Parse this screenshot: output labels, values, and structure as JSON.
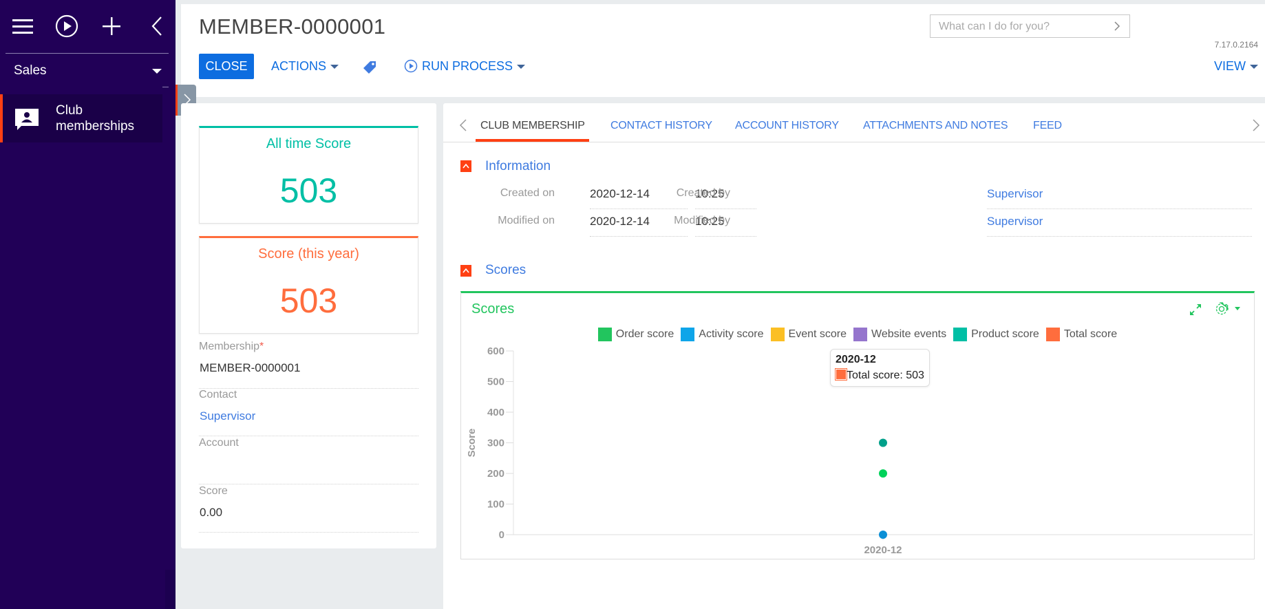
{
  "sidebar": {
    "icons": [
      "menu-icon",
      "run-process-icon",
      "add-icon",
      "collapse-left-icon"
    ],
    "section": "Sales",
    "items": [
      {
        "label_line1": "Club",
        "label_line2": "memberships",
        "icon": "membership-card-icon",
        "active": true
      }
    ],
    "accent_color": "#ff4013",
    "background_color": "#210057"
  },
  "header": {
    "title": "MEMBER-0000001",
    "close_label": "CLOSE",
    "actions_label": "ACTIONS",
    "tag_icon": "tag-icon",
    "run_process_label": "RUN PROCESS",
    "search_placeholder": "What can I do for you?",
    "search_value": "",
    "version": "7.17.0.2164",
    "view_label": "VIEW"
  },
  "left_panel": {
    "tiles": [
      {
        "label": "All time Score",
        "value": "503",
        "color": "#00bfa5"
      },
      {
        "label": "Score (this year)",
        "value": "503",
        "color": "#ff6d3d"
      }
    ],
    "fields": [
      {
        "label": "Membership",
        "required": "*",
        "value": "MEMBER-0000001",
        "is_link": false
      },
      {
        "label": "Contact",
        "value": "Supervisor",
        "is_link": true
      },
      {
        "label": "Account",
        "value": "",
        "is_link": true
      },
      {
        "label": "Score",
        "value": "0.00",
        "is_link": false
      }
    ]
  },
  "tabs": {
    "items": [
      {
        "label": "CLUB MEMBERSHIP",
        "active": true
      },
      {
        "label": "CONTACT HISTORY",
        "active": false
      },
      {
        "label": "ACCOUNT HISTORY",
        "active": false
      },
      {
        "label": "ATTACHMENTS AND NOTES",
        "active": false
      },
      {
        "label": "FEED",
        "active": false
      }
    ]
  },
  "information": {
    "title": "Information",
    "created_on_label": "Created on",
    "created_on_date": "2020-12-14",
    "created_on_time": "10:25",
    "modified_on_label": "Modified on",
    "modified_on_date": "2020-12-14",
    "modified_on_time": "10:25",
    "created_by_label": "Created by",
    "created_by": "Supervisor",
    "modified_by_label": "Modified by",
    "modified_by": "Supervisor"
  },
  "scores_group": {
    "title": "Scores"
  },
  "chart_data": {
    "type": "scatter",
    "title": "Scores",
    "xlabel": "",
    "ylabel": "Score",
    "categories": [
      "2020-12"
    ],
    "ylim": [
      0,
      600
    ],
    "yticks": [
      0,
      100,
      200,
      300,
      400,
      500,
      600
    ],
    "grid": false,
    "legend_position": "top-center",
    "series": [
      {
        "name": "Order score",
        "color": "#22c55e",
        "values": [
          200
        ]
      },
      {
        "name": "Activity score",
        "color": "#0ea5e9",
        "values": [
          0
        ]
      },
      {
        "name": "Event score",
        "color": "#fbbf24",
        "values": [
          null
        ]
      },
      {
        "name": "Website events",
        "color": "#9575cd",
        "values": [
          null
        ]
      },
      {
        "name": "Product score",
        "color": "#00bfa5",
        "values": [
          300
        ]
      },
      {
        "name": "Total score",
        "color": "#ff6d3d",
        "values": [
          503
        ]
      }
    ],
    "tooltip": {
      "title": "2020-12",
      "series": "Total score",
      "text": "Total score: 503"
    }
  }
}
